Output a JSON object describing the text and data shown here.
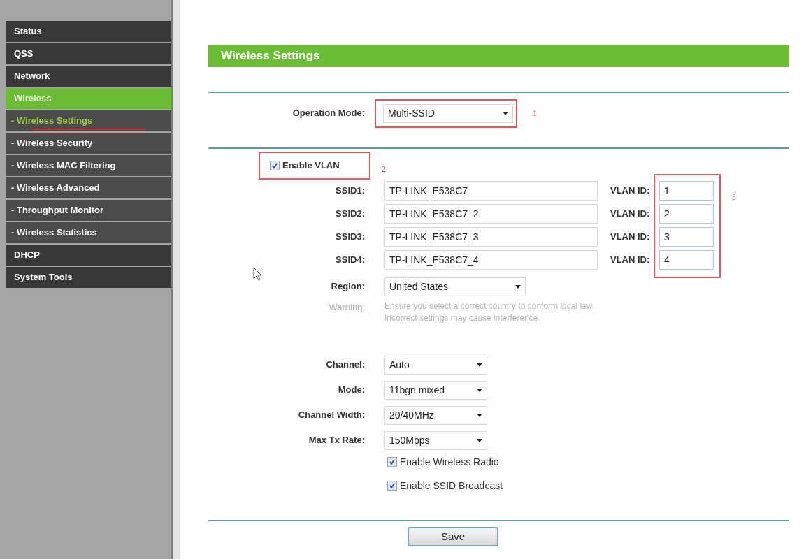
{
  "sidebar": {
    "items": [
      {
        "label": "Status",
        "selected": false
      },
      {
        "label": "QSS",
        "selected": false
      },
      {
        "label": "Network",
        "selected": false
      },
      {
        "label": "Wireless",
        "selected": true,
        "children": [
          {
            "label": "- Wireless Settings",
            "selected": true
          },
          {
            "label": "- Wireless Security",
            "selected": false
          },
          {
            "label": "- Wireless MAC Filtering",
            "selected": false
          },
          {
            "label": "- Wireless Advanced",
            "selected": false
          },
          {
            "label": "- Throughput Monitor",
            "selected": false
          },
          {
            "label": "- Wireless Statistics",
            "selected": false
          }
        ]
      },
      {
        "label": "DHCP",
        "selected": false
      },
      {
        "label": "System Tools",
        "selected": false
      }
    ]
  },
  "panel": {
    "title": "Wireless Settings",
    "operation_mode": {
      "label": "Operation Mode:",
      "value": "Multi-SSID",
      "annotation": "1"
    },
    "enable_vlan": {
      "label": "Enable VLAN",
      "checked": true,
      "annotation": "2"
    },
    "ssids": [
      {
        "label": "SSID1:",
        "value": "TP-LINK_E538C7",
        "vlan_label": "VLAN ID:",
        "vlan_id": "1"
      },
      {
        "label": "SSID2:",
        "value": "TP-LINK_E538C7_2",
        "vlan_label": "VLAN ID:",
        "vlan_id": "2"
      },
      {
        "label": "SSID3:",
        "value": "TP-LINK_E538C7_3",
        "vlan_label": "VLAN ID:",
        "vlan_id": "3"
      },
      {
        "label": "SSID4:",
        "value": "TP-LINK_E538C7_4",
        "vlan_label": "VLAN ID:",
        "vlan_id": "4"
      }
    ],
    "vlan_annotation": "3",
    "region": {
      "label": "Region:",
      "value": "United States"
    },
    "warning": {
      "label": "Warning:",
      "lines": [
        "Ensure you select a correct country to conform local law.",
        "Incorrect settings may cause interference."
      ]
    },
    "selects": [
      {
        "label": "Channel:",
        "value": "Auto"
      },
      {
        "label": "Mode:",
        "value": "11bgn mixed"
      },
      {
        "label": "Channel Width:",
        "value": "20/40MHz"
      },
      {
        "label": "Max Tx Rate:",
        "value": "150Mbps"
      }
    ],
    "checkboxes": [
      {
        "label": "Enable Wireless Radio",
        "checked": true
      },
      {
        "label": "Enable SSID Broadcast",
        "checked": true
      }
    ],
    "save": "Save"
  }
}
